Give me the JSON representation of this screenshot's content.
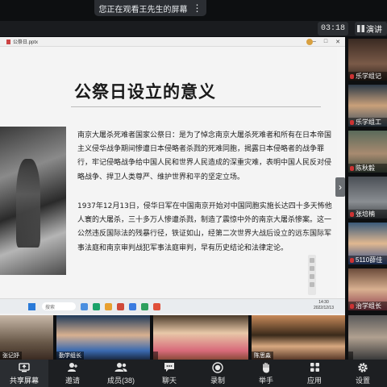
{
  "banner": {
    "text": "您正在观看王先生的屏幕",
    "more": "⋮"
  },
  "top": {
    "timer": "03:18",
    "presenter_label": "演讲"
  },
  "ppt": {
    "file_name": "公祭日.pptx",
    "slide_title": "公祭日设立的意义",
    "paragraph1": "南京大屠杀死难者国家公祭日：是为了悼念南京大屠杀死难者和所有在日本帝国主义侵华战争期间惨遭日本侵略者杀戮的死难同胞，揭露日本侵略者的战争罪行，牢记侵略战争给中国人民和世界人民造成的深重灾难，表明中国人民反对侵略战争、捍卫人类尊严、维护世界和平的坚定立场。",
    "paragraph2": "1937年12月13日，侵华日军在中国南京开始对中国同胞实施长达四十多天怖他人寰的大屠杀，三十多万人惨遭杀戮，制造了震惊中外的南京大屠杀惨案。这一公然违反国际法的残暴行径，铁证如山，经第二次世界大战后设立的远东国际军事法庭和南京审判战犯军事法庭审判，早有历史结论和法律定论。"
  },
  "taskbar": {
    "search_placeholder": "搜索",
    "time": "14:30",
    "date": "2022/12/13"
  },
  "side_participants": [
    {
      "name": "乐学组记"
    },
    {
      "name": "乐学组工"
    },
    {
      "name": "陈秋毅"
    },
    {
      "name": "张培楠"
    },
    {
      "name": "5110薛佳"
    },
    {
      "name": "治学组长"
    }
  ],
  "gallery": [
    {
      "name": "张记妤"
    },
    {
      "name": "勤学组长"
    },
    {
      "name": ""
    },
    {
      "name": "陈思淼"
    },
    {
      "name": ""
    }
  ],
  "toolbar": {
    "share": "共享屏幕",
    "invite": "邀请",
    "members": "成员(38)",
    "chat": "聊天",
    "record": "录制",
    "raise_hand": "举手",
    "apps": "应用",
    "settings": "设置"
  },
  "colors": {
    "toolbar_bg": "#1d1f22",
    "accent_red": "#d33333",
    "share_tile": "#2a2d31"
  }
}
